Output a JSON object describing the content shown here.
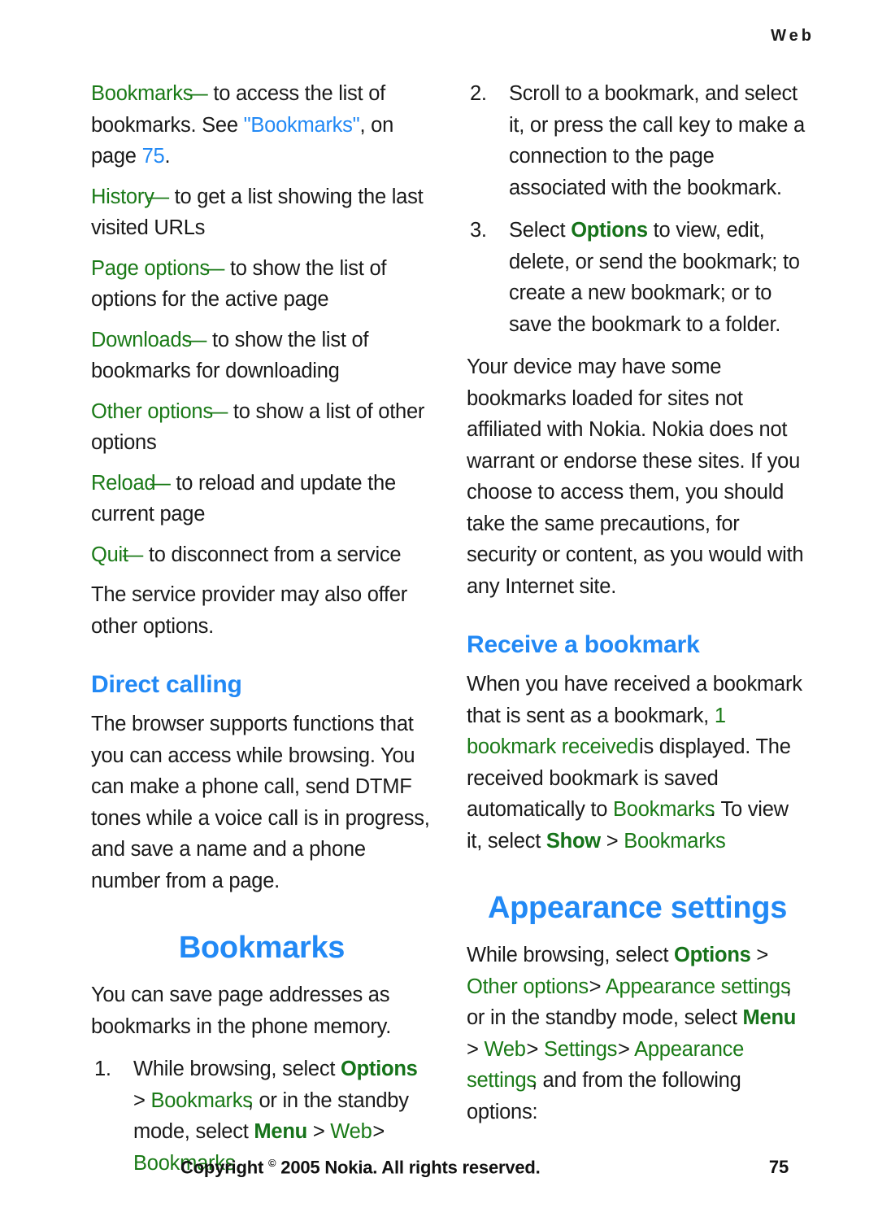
{
  "running_head": "Web",
  "left_column": {
    "option_list": [
      {
        "term": "Bookmarks",
        "dash": "—",
        "desc_before": " to access the list of bookmarks. See ",
        "xref": "\"Bookmarks\"",
        "desc_mid": ", on page ",
        "xref_page": "75",
        "desc_after": "."
      },
      {
        "term": "History",
        "dash": "—",
        "desc": " to get a list showing the last visited URLs"
      },
      {
        "term": "Page options",
        "dash": "—",
        "desc": " to show the list of options for the active page"
      },
      {
        "term": "Downloads",
        "dash": "—",
        "desc": " to show the list of bookmarks for downloading"
      },
      {
        "term": "Other options",
        "dash": "—",
        "desc": " to show a list of other options"
      },
      {
        "term": "Reload",
        "dash": "—",
        "desc": " to reload and update the current page"
      },
      {
        "term": "Quit",
        "dash": "—",
        "desc": " to disconnect from a service"
      }
    ],
    "closing_paragraph": "The service provider may also offer other options.",
    "direct_calling": {
      "heading": "Direct calling",
      "body": "The browser supports functions that you can access while browsing. You can make a phone call, send DTMF tones while a voice call is in progress, and save a name and a phone number from a page."
    },
    "bookmarks_chapter": {
      "heading": "Bookmarks",
      "intro": "You can save page addresses as bookmarks in the phone memory.",
      "step1": {
        "number": "1.",
        "t1": "While browsing, select ",
        "ui1": "Options",
        "t2": " > ",
        "ui2": "Bookmarks",
        "t3": ", or in the standby mode, select ",
        "ui3": "Menu",
        "t4": " > ",
        "ui4": "Web",
        "t5": " > ",
        "ui5": "Bookmarks"
      }
    }
  },
  "right_column": {
    "step2": {
      "number": "2.",
      "text": "Scroll to a bookmark, and select it, or press the call key to make a connection to the page associated with the bookmark."
    },
    "step3": {
      "number": "3.",
      "t1": "Select ",
      "ui1": "Options",
      "t2": " to view, edit, delete, or send the bookmark; to create a new bookmark; or to save the bookmark to a folder."
    },
    "disclaimer": "Your device may have some bookmarks loaded for sites not affiliated with Nokia. Nokia does not warrant or endorse these sites. If you choose to access them, you should take the same precautions, for security or content, as you would with any Internet site.",
    "receive_bookmark": {
      "heading": "Receive a bookmark",
      "t1": "When you have received a bookmark that is sent as a bookmark, ",
      "ui1": "1 bookmark received",
      "t2": " is displayed. The received bookmark is saved automatically to ",
      "ui2": "Bookmarks",
      "t3": ". To view it, select ",
      "ui3": "Show",
      "t4": " > ",
      "ui4": "Bookmarks"
    },
    "appearance_chapter": {
      "heading": "Appearance settings",
      "t1": "While browsing, select ",
      "ui1": "Options",
      "t2": " > ",
      "ui2": "Other options",
      "t3": " > ",
      "ui3": "Appearance settings",
      "t4": ", or in the standby mode, select ",
      "ui4": "Menu",
      "t5": " > ",
      "ui5": "Web",
      "t6": " > ",
      "ui6": "Settings",
      "t7": " > ",
      "ui7": "Appearance settings",
      "t8": ", and from the following options:"
    }
  },
  "footer": {
    "copyright_pre": "Copyright ",
    "copyright_mark": "©",
    "copyright_post": " 2005 Nokia. All rights reserved.",
    "page_number": "75"
  },
  "colors": {
    "ui_green": "#1a7a17",
    "heading_blue": "#2289f5",
    "body_text": "#1a1a1a"
  }
}
